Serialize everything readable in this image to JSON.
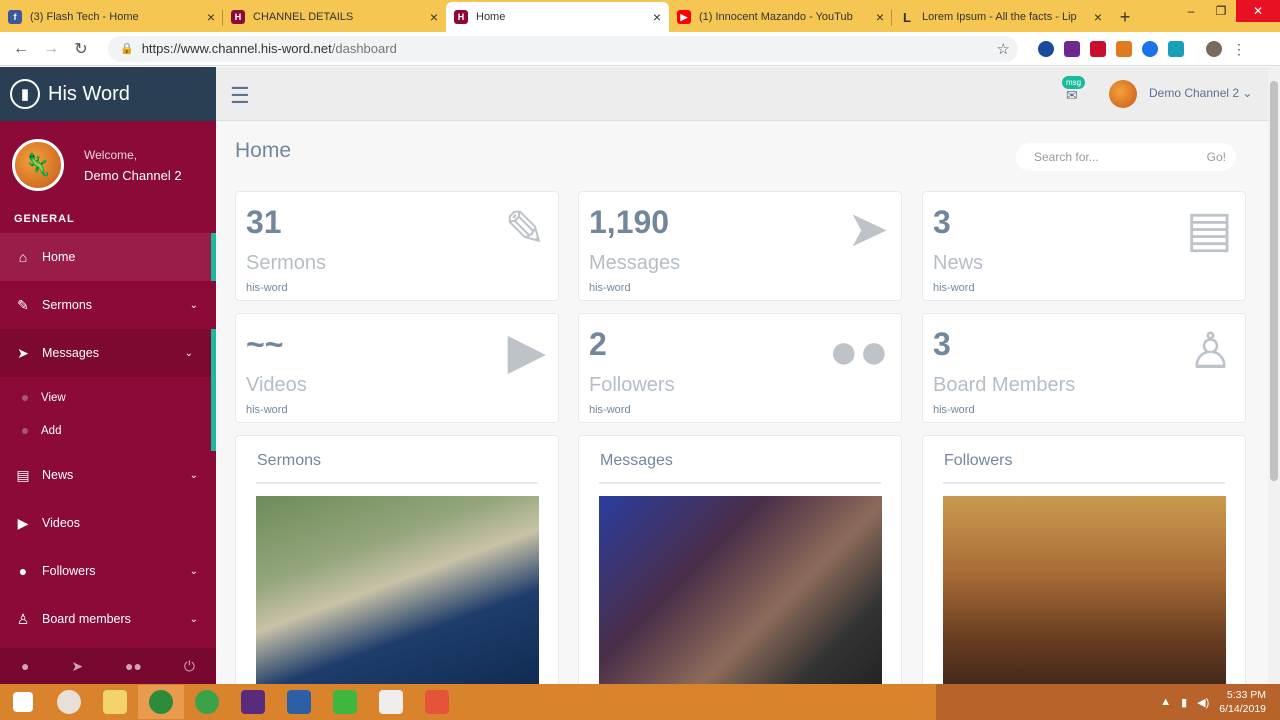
{
  "browser": {
    "tabs": [
      {
        "label": "(3) Flash Tech - Home",
        "color": "#3b5998",
        "glyph": "f",
        "active": false
      },
      {
        "label": "CHANNEL DETAILS",
        "color": "#8b0a38",
        "glyph": "H",
        "active": false
      },
      {
        "label": "Home",
        "color": "#8b0a38",
        "glyph": "H",
        "active": true
      },
      {
        "label": "(1) Innocent Mazando - YouTub",
        "color": "#ff0000",
        "glyph": "▶",
        "active": false
      },
      {
        "label": "Lorem Ipsum - All the facts - Lip",
        "color": "#ffffff",
        "glyph": "L",
        "active": false
      }
    ],
    "url_host": "https://www.channel.his-word.net",
    "url_path": "/dashboard"
  },
  "sidebar": {
    "brand": "His Word",
    "welcome": "Welcome,",
    "username": "Demo Channel 2",
    "section": "GENERAL",
    "items": [
      {
        "label": "Home",
        "icon": "home-icon",
        "glyph": "⌂",
        "chevron": false
      },
      {
        "label": "Sermons",
        "icon": "edit-icon",
        "glyph": "✎",
        "chevron": true
      },
      {
        "label": "Messages",
        "icon": "paper-plane-icon",
        "glyph": "➤",
        "chevron": true
      },
      {
        "label": "News",
        "icon": "newspaper-icon",
        "glyph": "▤",
        "chevron": true
      },
      {
        "label": "Videos",
        "icon": "youtube-icon",
        "glyph": "▶",
        "chevron": false
      },
      {
        "label": "Followers",
        "icon": "users-icon",
        "glyph": "👥",
        "chevron": true
      },
      {
        "label": "Board members",
        "icon": "user-md-icon",
        "glyph": "👤",
        "chevron": true
      }
    ],
    "submenu": [
      "View",
      "Add"
    ]
  },
  "topnav": {
    "badge": "msg",
    "user": "Demo Channel 2"
  },
  "main": {
    "title": "Home",
    "search_placeholder": "Search for...",
    "search_button": "Go!",
    "tiles": [
      {
        "count": "31",
        "label": "Sermons",
        "sub": "his-word",
        "icon": "edit-icon",
        "glyph": "✎"
      },
      {
        "count": "1,190",
        "label": "Messages",
        "sub": "his-word",
        "icon": "paper-plane-icon",
        "glyph": "➤"
      },
      {
        "count": "3",
        "label": "News",
        "sub": "his-word",
        "icon": "newspaper-icon",
        "glyph": "▤"
      },
      {
        "count": "~~",
        "label": "Videos",
        "sub": "his-word",
        "icon": "youtube-icon",
        "glyph": "▶"
      },
      {
        "count": "2",
        "label": "Followers",
        "sub": "his-word",
        "icon": "users-icon",
        "glyph": "👥"
      },
      {
        "count": "3",
        "label": "Board Members",
        "sub": "his-word",
        "icon": "user-md-icon",
        "glyph": "👤"
      }
    ],
    "panels": [
      {
        "title": "Sermons"
      },
      {
        "title": "Messages"
      },
      {
        "title": "Followers"
      }
    ]
  },
  "taskbar": {
    "time": "5:33 PM",
    "date": "6/14/2019"
  },
  "colors": {
    "sidebar": "#8b0a38",
    "brand_bar": "#2a3f54",
    "accent": "#1abb9c",
    "taskbar": "#d9832d",
    "browser_tabs": "#f6c652"
  }
}
